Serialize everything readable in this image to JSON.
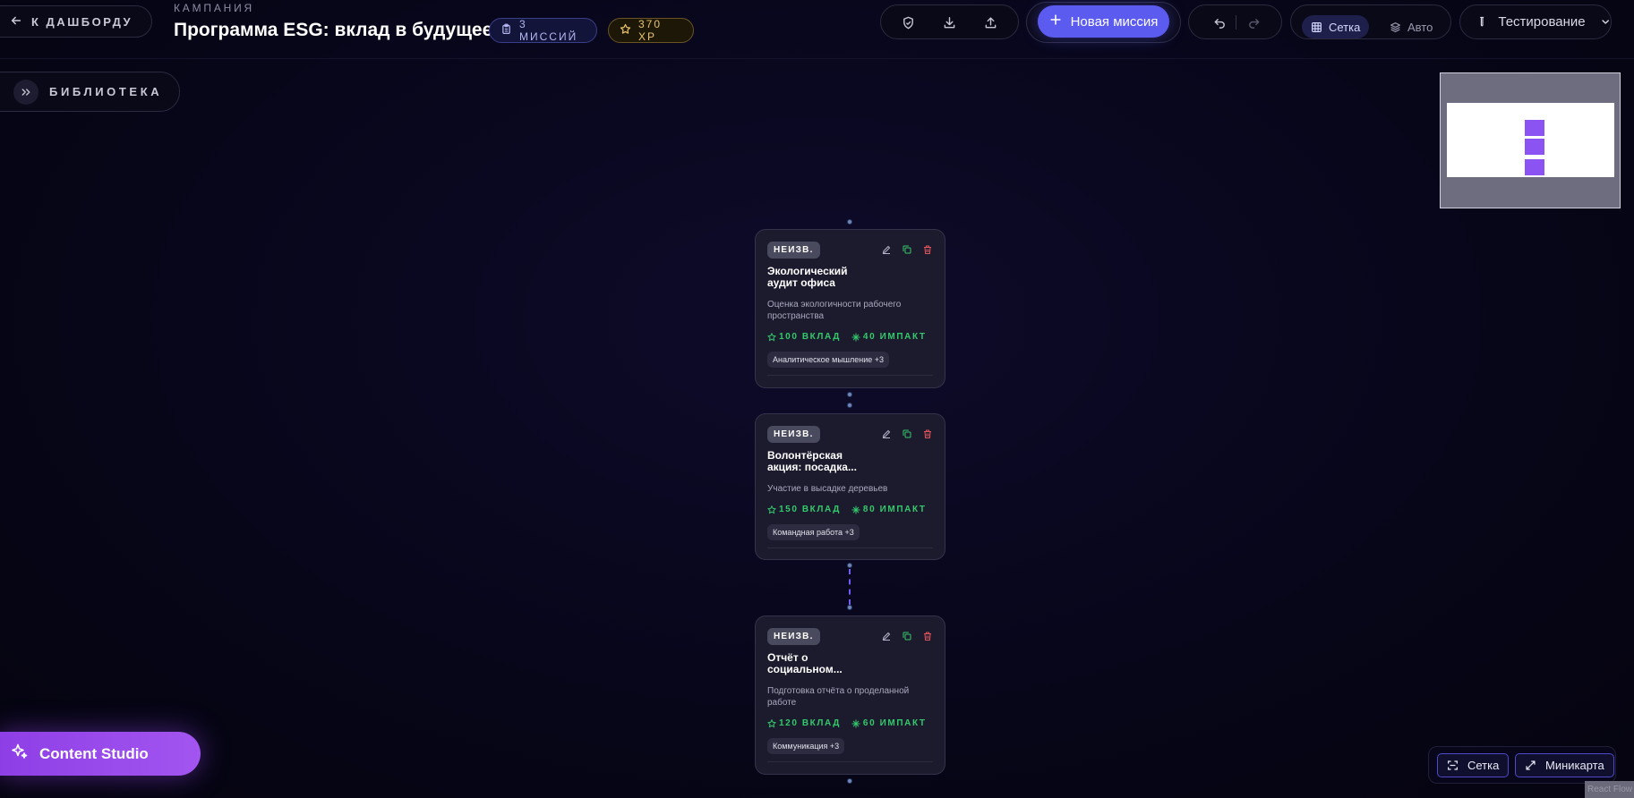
{
  "header": {
    "back_label": "К ДАШБОРДУ",
    "kicker": "КАМПАНИЯ",
    "title": "Программа ESG: вклад в будущее",
    "missions_badge": "3 МИССИЙ",
    "xp_badge": "370 XP"
  },
  "toolbar": {
    "new_mission_label": "Новая миссия",
    "view_grid_label": "Сетка",
    "view_auto_label": "Авто",
    "active_view": "Сетка",
    "environment_label": "Тестирование"
  },
  "library": {
    "label": "БИБЛИОТЕКА"
  },
  "missions": [
    {
      "status": "НЕИЗВ.",
      "title": "Экологический аудит офиса",
      "description": "Оценка экологичности рабочего пространства",
      "contribution": "100 ВКЛАД",
      "impact": "40 ИМПАКТ",
      "skill_tag": "Аналитическое мышление +3"
    },
    {
      "status": "НЕИЗВ.",
      "title": "Волонтёрская акция: посадка...",
      "description": "Участие в высадке деревьев",
      "contribution": "150 ВКЛАД",
      "impact": "80 ИМПАКТ",
      "skill_tag": "Командная работа +3"
    },
    {
      "status": "НЕИЗВ.",
      "title": "Отчёт о социальном...",
      "description": "Подготовка отчёта о проделанной работе",
      "contribution": "120 ВКЛАД",
      "impact": "60 ИМПАКТ",
      "skill_tag": "Коммуникация +3"
    }
  ],
  "bottom": {
    "content_studio_label": "Content Studio",
    "fit_view_label": "Сетка",
    "minimap_label": "Миникарта",
    "attribution": "React Flow"
  },
  "colors": {
    "accent": "#5b5bf0",
    "studio_gradient_start": "#8d3fe6",
    "stat_green": "#32c96a",
    "minimap_node": "#8b54f2",
    "background": "#07061a"
  },
  "icons": {
    "back": "arrow-left-icon",
    "missions_badge": "clipboard-icon",
    "xp_badge": "star-icon",
    "validate": "shield-check-icon",
    "download": "download-icon",
    "upload": "upload-icon",
    "new_mission": "plus-icon",
    "undo": "undo-icon",
    "redo": "redo-icon",
    "grid": "grid-icon",
    "auto": "layers-icon",
    "environment": "test-tube-icon",
    "library": "chevrons-right-icon",
    "studio": "sparkles-icon",
    "fit_view": "scan-icon",
    "minimap": "expand-icon"
  }
}
